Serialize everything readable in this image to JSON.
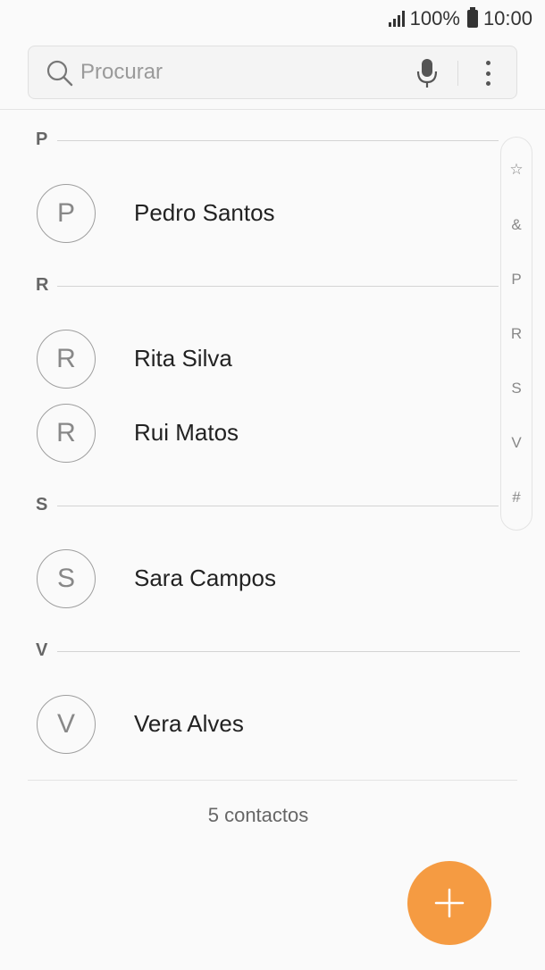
{
  "status_bar": {
    "battery": "100%",
    "time": "10:00"
  },
  "search": {
    "placeholder": "Procurar",
    "icons": [
      "search-icon",
      "mic-icon",
      "more-vert-icon"
    ]
  },
  "sections": [
    {
      "letter": "P",
      "contacts": [
        {
          "initial": "P",
          "name": "Pedro Santos"
        }
      ]
    },
    {
      "letter": "R",
      "contacts": [
        {
          "initial": "R",
          "name": "Rita Silva"
        },
        {
          "initial": "R",
          "name": "Rui Matos"
        }
      ]
    },
    {
      "letter": "S",
      "contacts": [
        {
          "initial": "S",
          "name": "Sara Campos"
        }
      ]
    },
    {
      "letter": "V",
      "contacts": [
        {
          "initial": "V",
          "name": "Vera Alves"
        }
      ]
    }
  ],
  "index_bar": [
    "☆",
    "&",
    "P",
    "R",
    "S",
    "V",
    "#"
  ],
  "footer": {
    "count": "5 contactos"
  },
  "fab": {
    "icon": "add-icon",
    "color": "#f59b42"
  }
}
